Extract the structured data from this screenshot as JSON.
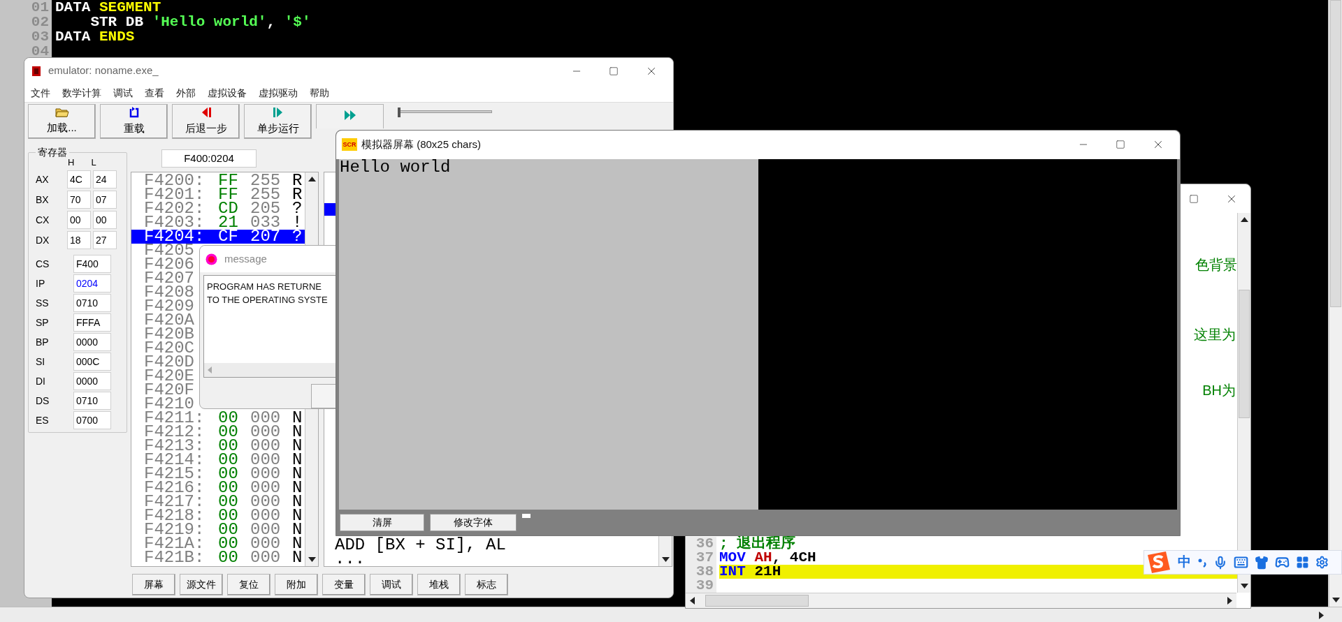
{
  "editor": {
    "lines": [
      {
        "number": "01",
        "tokens": [
          {
            "text": "DATA ",
            "kind": "plain"
          },
          {
            "text": "SEGMENT",
            "kind": "directive"
          }
        ]
      },
      {
        "number": "02",
        "tokens": [
          {
            "text": "    STR DB ",
            "kind": "plain"
          },
          {
            "text": "'Hello world'",
            "kind": "string"
          },
          {
            "text": ", ",
            "kind": "plain"
          },
          {
            "text": "'$'",
            "kind": "string"
          }
        ]
      },
      {
        "number": "03",
        "tokens": [
          {
            "text": "DATA ",
            "kind": "plain"
          },
          {
            "text": "ENDS",
            "kind": "directive"
          }
        ]
      },
      {
        "number": "04"
      }
    ]
  },
  "emulator": {
    "title": "emulator: noname.exe_",
    "menu": [
      "文件",
      "数学计算",
      "调试",
      "查看",
      "外部",
      "虚拟设备",
      "虚拟驱动",
      "帮助"
    ],
    "toolbar": [
      "加载...",
      "重载",
      "后退一步",
      "单步运行"
    ],
    "delay_slider": {
      "level": 0
    },
    "registers": {
      "title": "寄存器",
      "columns": [
        "H",
        "L"
      ],
      "pairs": [
        {
          "name": "AX",
          "h": "4C",
          "l": "24"
        },
        {
          "name": "BX",
          "h": "70",
          "l": "07"
        },
        {
          "name": "CX",
          "h": "00",
          "l": "00"
        },
        {
          "name": "DX",
          "h": "18",
          "l": "27"
        }
      ],
      "words": [
        {
          "name": "CS",
          "value": "F400",
          "changed": false
        },
        {
          "name": "IP",
          "value": "0204",
          "changed": true
        },
        {
          "name": "SS",
          "value": "0710",
          "changed": false
        },
        {
          "name": "SP",
          "value": "FFFA",
          "changed": false
        },
        {
          "name": "BP",
          "value": "0000",
          "changed": false
        },
        {
          "name": "SI",
          "value": "000C",
          "changed": false
        },
        {
          "name": "DI",
          "value": "0000",
          "changed": false
        },
        {
          "name": "DS",
          "value": "0710",
          "changed": false
        },
        {
          "name": "ES",
          "value": "0700",
          "changed": false
        }
      ]
    },
    "address": "F400:0204",
    "memory": [
      {
        "address": "F4200:",
        "hex": "FF",
        "dec": "255",
        "char": "R",
        "selected": false
      },
      {
        "address": "F4201:",
        "hex": "FF",
        "dec": "255",
        "char": "R",
        "selected": false
      },
      {
        "address": "F4202:",
        "hex": "CD",
        "dec": "205",
        "char": "?",
        "selected": false
      },
      {
        "address": "F4203:",
        "hex": "21",
        "dec": "033",
        "char": "!",
        "selected": false
      },
      {
        "address": "F4204:",
        "hex": "CF",
        "dec": "207",
        "char": "?",
        "selected": true
      },
      {
        "address": "F4205",
        "selected": false
      },
      {
        "address": "F4206",
        "selected": false
      },
      {
        "address": "F4207",
        "selected": false
      },
      {
        "address": "F4208",
        "selected": false
      },
      {
        "address": "F4209",
        "selected": false
      },
      {
        "address": "F420A",
        "selected": false
      },
      {
        "address": "F420B",
        "selected": false
      },
      {
        "address": "F420C",
        "selected": false
      },
      {
        "address": "F420D",
        "selected": false
      },
      {
        "address": "F420E",
        "selected": false
      },
      {
        "address": "F420F",
        "selected": false
      },
      {
        "address": "F4210",
        "selected": false
      },
      {
        "address": "F4211:",
        "hex": "00",
        "dec": "000",
        "char": "N",
        "selected": false
      },
      {
        "address": "F4212:",
        "hex": "00",
        "dec": "000",
        "char": "N",
        "selected": false
      },
      {
        "address": "F4213:",
        "hex": "00",
        "dec": "000",
        "char": "N",
        "selected": false
      },
      {
        "address": "F4214:",
        "hex": "00",
        "dec": "000",
        "char": "N",
        "selected": false
      },
      {
        "address": "F4215:",
        "hex": "00",
        "dec": "000",
        "char": "N",
        "selected": false
      },
      {
        "address": "F4216:",
        "hex": "00",
        "dec": "000",
        "char": "N",
        "selected": false
      },
      {
        "address": "F4217:",
        "hex": "00",
        "dec": "000",
        "char": "N",
        "selected": false
      },
      {
        "address": "F4218:",
        "hex": "00",
        "dec": "000",
        "char": "N",
        "selected": false
      },
      {
        "address": "F4219:",
        "hex": "00",
        "dec": "000",
        "char": "N",
        "selected": false
      },
      {
        "address": "F421A:",
        "hex": "00",
        "dec": "000",
        "char": "N",
        "selected": false
      },
      {
        "address": "F421B:",
        "hex": "00",
        "dec": "000",
        "char": "N",
        "selected": false
      }
    ],
    "disassembly": [
      "ADD [BX + SI], AL",
      "..."
    ],
    "bottom_buttons": [
      "屏幕",
      "源文件",
      "复位",
      "附加",
      "变量",
      "调试",
      "堆栈",
      "标志"
    ]
  },
  "message": {
    "title": "message",
    "lines": [
      "PROGRAM HAS RETURNE",
      "TO THE OPERATING SYSTE"
    ]
  },
  "simulator": {
    "icon_label": "SCR",
    "title": "模拟器屏幕 (80x25 chars)",
    "screen_text": "Hello world",
    "buttons": [
      "清屏",
      "修改字体"
    ]
  },
  "source": {
    "fragments": [
      "色背景",
      "这里为",
      "BH为"
    ],
    "lines": [
      {
        "number": "36",
        "highlighted": false,
        "tokens": [
          {
            "text": "; 退出程序",
            "kind": "comment"
          }
        ]
      },
      {
        "number": "37",
        "highlighted": false,
        "tokens": [
          {
            "text": "MOV ",
            "kind": "instr"
          },
          {
            "text": "AH",
            "kind": "reg"
          },
          {
            "text": ", 4CH",
            "kind": "plain"
          }
        ]
      },
      {
        "number": "38",
        "highlighted": true,
        "tokens": [
          {
            "text": "INT ",
            "kind": "instr"
          },
          {
            "text": "21H",
            "kind": "plain"
          }
        ]
      },
      {
        "number": "39",
        "highlighted": false
      }
    ]
  },
  "ime": {
    "label": "中"
  }
}
